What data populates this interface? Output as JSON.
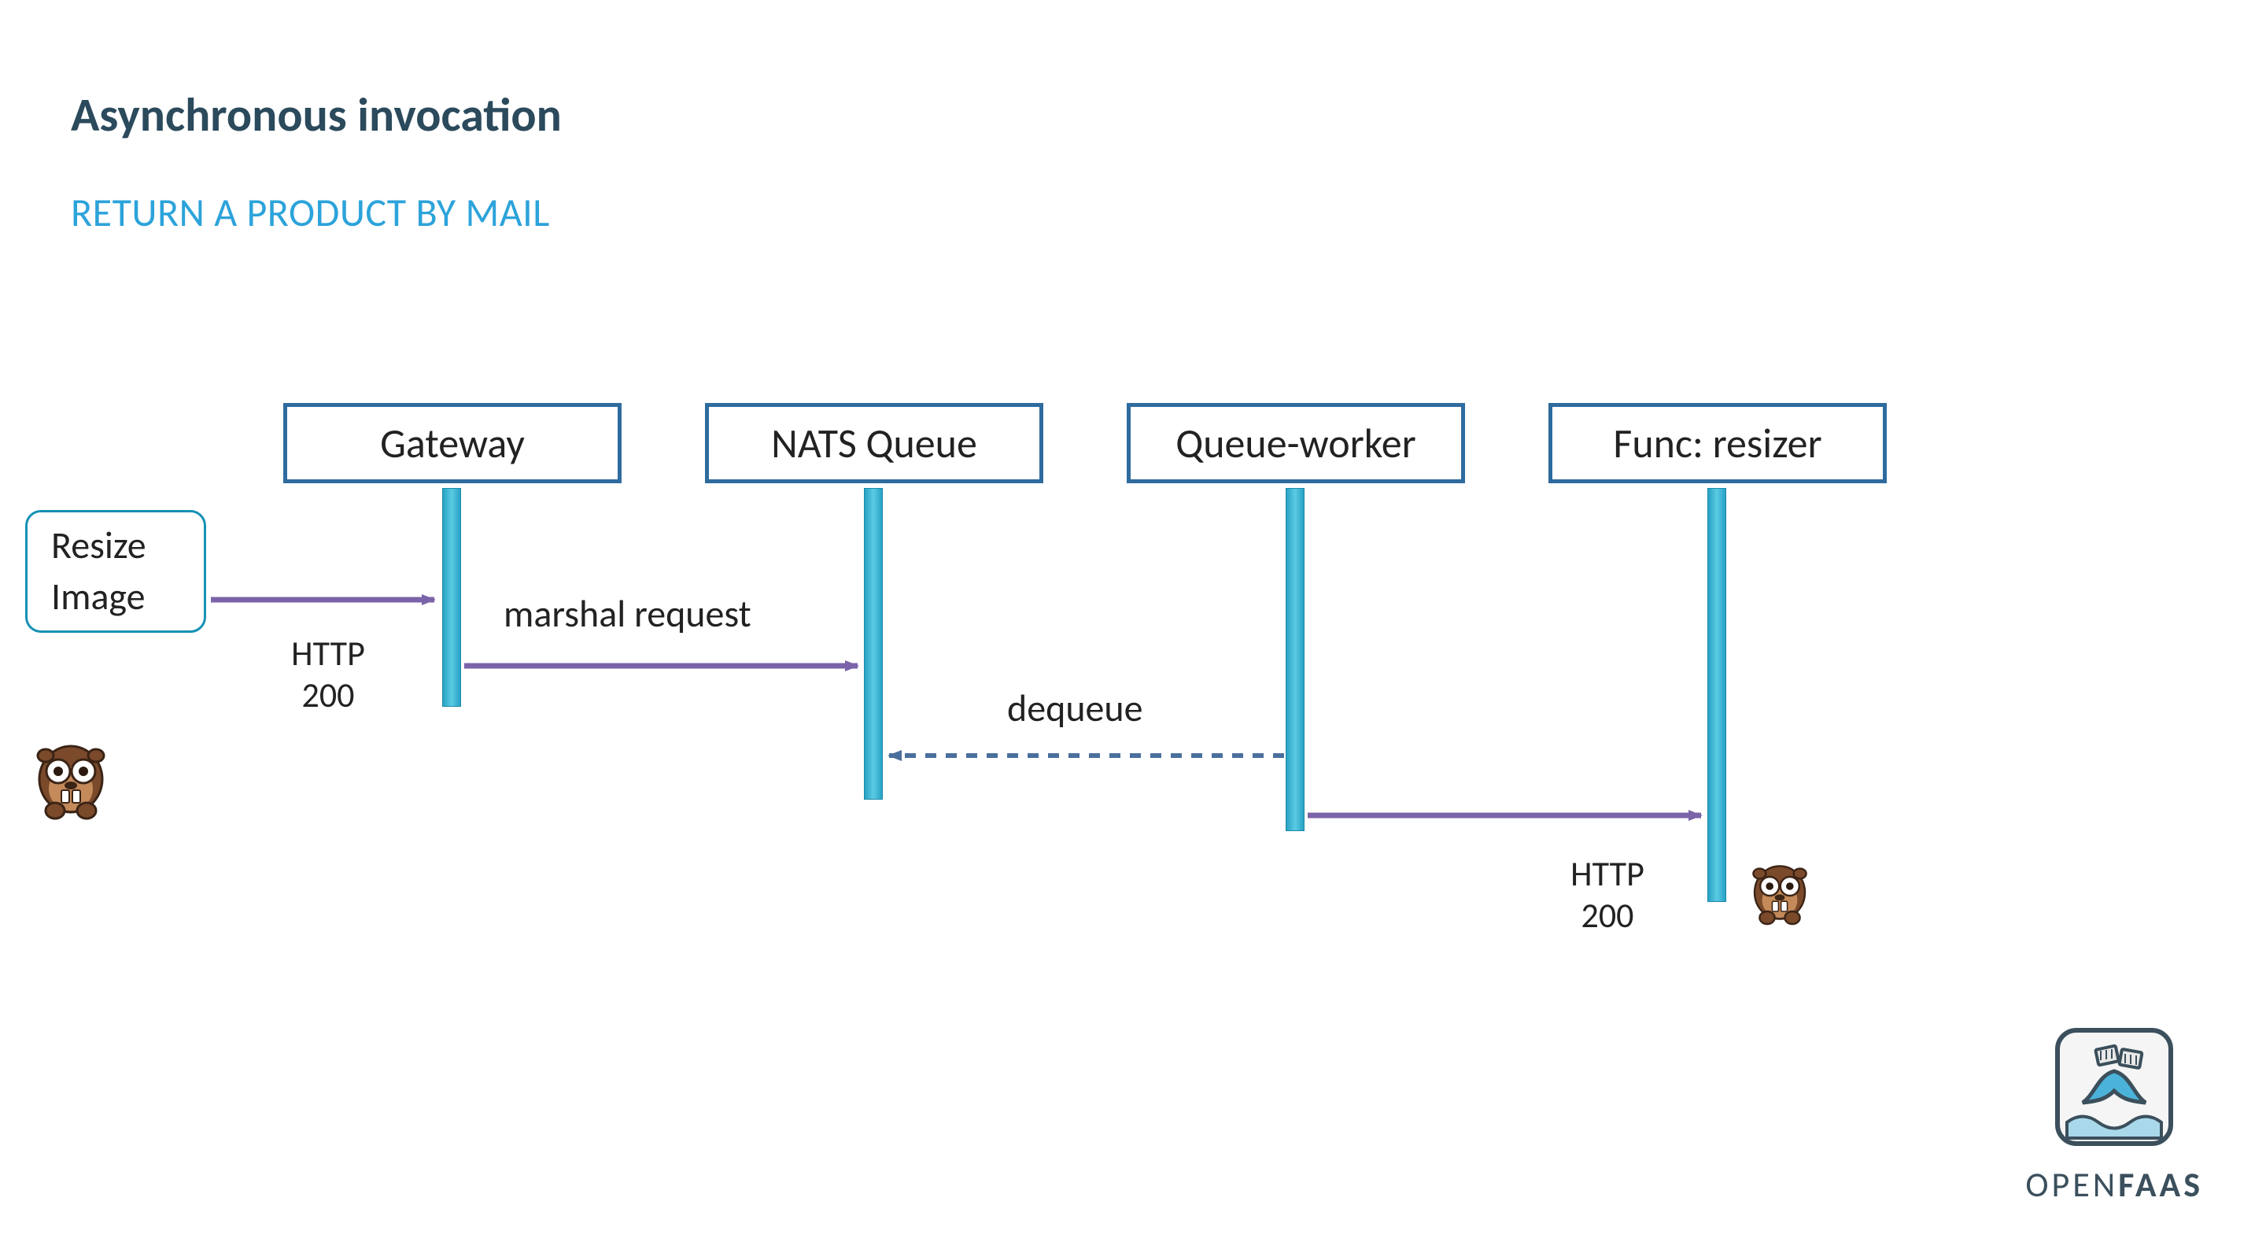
{
  "title": "Asynchronous invocation",
  "subtitle": "RETURN A PRODUCT BY MAIL",
  "actor": {
    "line1": "Resize",
    "line2": "Image"
  },
  "participants": {
    "gateway": "Gateway",
    "nats": "NATS Queue",
    "worker": "Queue-worker",
    "func": "Func: resizer"
  },
  "messages": {
    "marshal": "marshal request",
    "dequeue": "dequeue"
  },
  "sub_labels": {
    "left_http_line1": "HTTP",
    "left_http_line2": "200",
    "right_http_line1": "HTTP",
    "right_http_line2": "200"
  },
  "logo": {
    "open": "OPEN",
    "faas": "FAAS"
  }
}
